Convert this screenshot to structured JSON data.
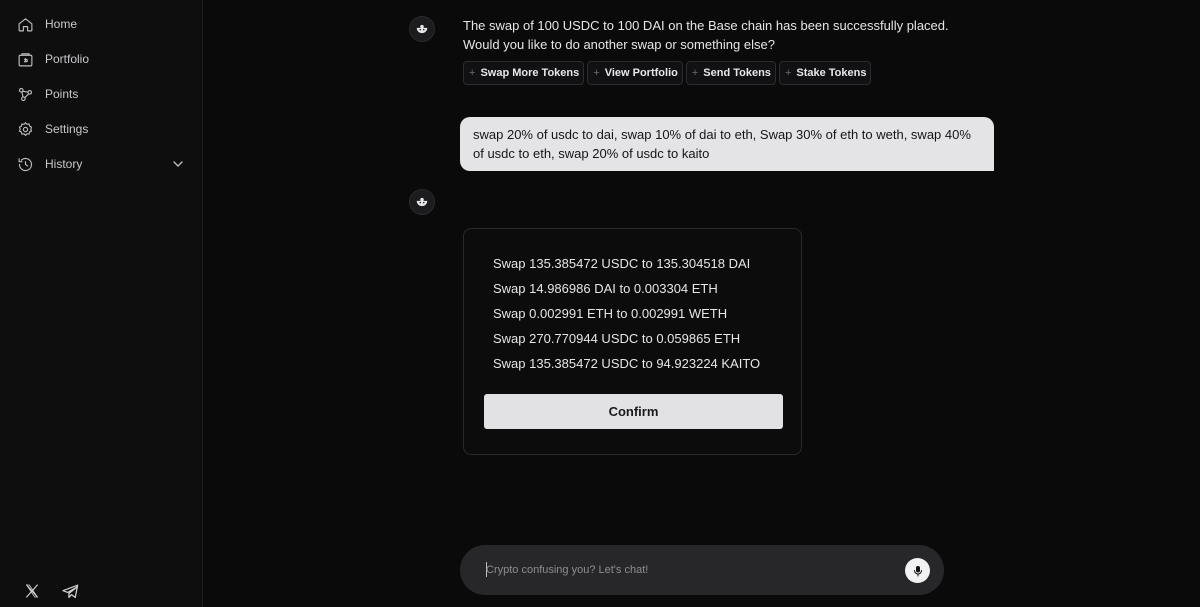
{
  "sidebar": {
    "items": [
      {
        "label": "Home",
        "icon": "home-icon"
      },
      {
        "label": "Portfolio",
        "icon": "wallet-icon"
      },
      {
        "label": "Points",
        "icon": "points-icon"
      },
      {
        "label": "Settings",
        "icon": "gear-icon"
      },
      {
        "label": "History",
        "icon": "history-icon"
      }
    ],
    "social": [
      "x-logo-icon",
      "telegram-icon"
    ]
  },
  "messages": {
    "bot_reply_line1": "The swap of 100 USDC to 100 DAI on the Base chain has been successfully placed.",
    "bot_reply_line2": "Would you like to do another swap or something else?",
    "suggestions": [
      "Swap More Tokens",
      "View Portfolio",
      "Send Tokens",
      "Stake Tokens"
    ],
    "user_message": "swap 20% of usdc to dai, swap 10% of dai to eth, Swap 30% of eth to weth, swap 40% of usdc to eth, swap 20% of usdc to kaito"
  },
  "swap_card": {
    "swaps": [
      "Swap 135.385472 USDC to 135.304518 DAI",
      "Swap 14.986986 DAI to 0.003304 ETH",
      "Swap 0.002991 ETH to 0.002991 WETH",
      "Swap 270.770944 USDC to 0.059865 ETH",
      "Swap 135.385472 USDC to 94.923224 KAITO"
    ],
    "confirm_label": "Confirm"
  },
  "chat_input": {
    "placeholder": "Crypto confusing you? Let's chat!"
  }
}
